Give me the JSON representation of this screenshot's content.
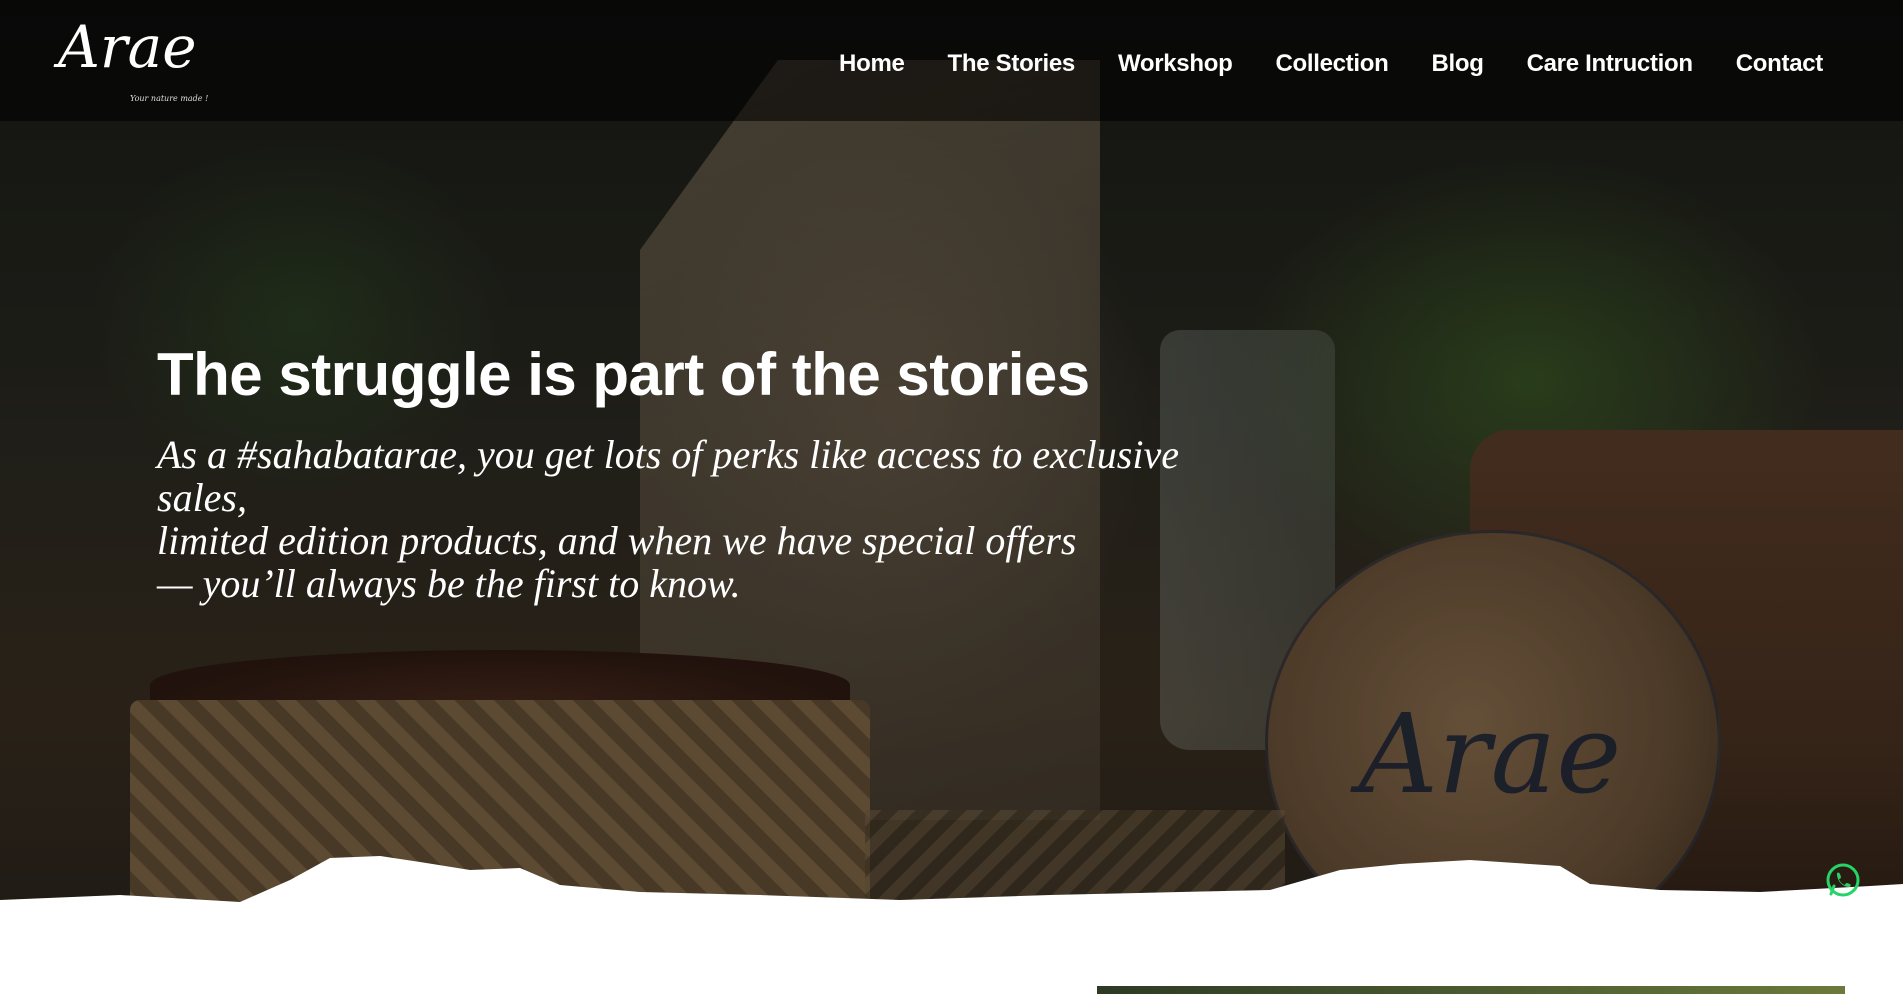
{
  "brand": {
    "logo_text": "Arae",
    "tagline": "Your nature made !"
  },
  "nav": {
    "items": [
      {
        "label": "Home"
      },
      {
        "label": "The Stories"
      },
      {
        "label": "Workshop"
      },
      {
        "label": "Collection"
      },
      {
        "label": "Blog"
      },
      {
        "label": "Care Intruction"
      },
      {
        "label": "Contact"
      }
    ]
  },
  "hero": {
    "headline": "The struggle is part of the stories",
    "line1": "As a #sahabatarae, you get lots of perks like access to exclusive sales,",
    "line2": "limited edition products, and when we have special offers",
    "line3": "— you’ll always be the first to know.",
    "disc_brand": "Arae"
  },
  "icons": {
    "whatsapp": "whatsapp-icon"
  },
  "colors": {
    "nav_text": "#ffffff",
    "headline": "#ffffff",
    "whatsapp": "#25d366"
  }
}
